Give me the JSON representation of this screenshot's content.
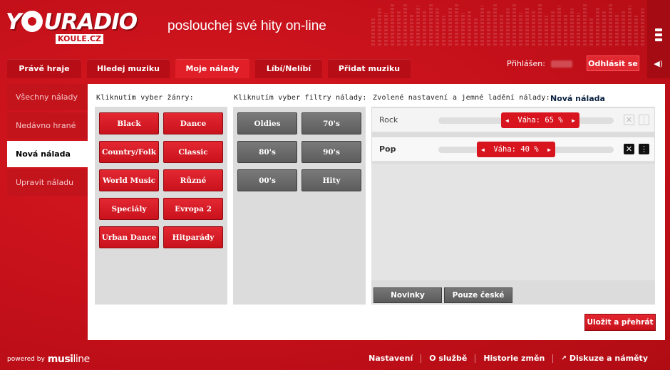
{
  "logo": {
    "main": "Y  URADIO",
    "sub": "KOULE.CZ"
  },
  "tagline": "poslouchej své hity on-line",
  "tabs": [
    {
      "label": "Právě hraje",
      "active": false
    },
    {
      "label": "Hledej muziku",
      "active": false
    },
    {
      "label": "Moje nálady",
      "active": true
    },
    {
      "label": "Líbí/Nelíbí",
      "active": false
    },
    {
      "label": "Přidat muziku",
      "active": false
    }
  ],
  "login": {
    "label": "Přihlášen:",
    "logout": "Odhlásit se"
  },
  "sidenav": [
    {
      "label": "Všechny nálady",
      "active": false
    },
    {
      "label": "Nedávno hrané",
      "active": false
    },
    {
      "label": "Nová nálada",
      "active": true
    },
    {
      "label": "Upravit náladu",
      "active": false
    }
  ],
  "genres": {
    "title": "Kliknutím vyber žánry:",
    "buttons": [
      "Black",
      "Dance",
      "Country/Folk",
      "Classic",
      "World Music",
      "Různé",
      "Speciály",
      "Evropa 2",
      "Urban Dance",
      "Hitparády"
    ]
  },
  "filters": {
    "title": "Kliknutím vyber filtry nálady:",
    "buttons": [
      "Oldies",
      "70's",
      "80's",
      "90's",
      "00's",
      "Hity"
    ]
  },
  "selected": {
    "title": "Zvolené nastavení a jemné ladění nálady:",
    "mood_name": "Nová nálada",
    "rows": [
      {
        "label": "Rock",
        "weight_text": "Váha: 65 %",
        "weight": 65
      },
      {
        "label": "Pop",
        "weight_text": "Váha: 40 %",
        "weight": 40
      }
    ],
    "bottom_buttons": [
      "Novinky",
      "Pouze české"
    ],
    "save": "Uložit a přehrát"
  },
  "footer": {
    "powered": "powered by",
    "brand": "musi",
    "brand_suffix": "line",
    "links": [
      "Nastavení",
      "O službě",
      "Historie změn",
      "Diskuze a náměty"
    ]
  },
  "colors": {
    "brand_red": "#c8101a",
    "button_red": "#d8151f",
    "button_grey": "#666666"
  }
}
